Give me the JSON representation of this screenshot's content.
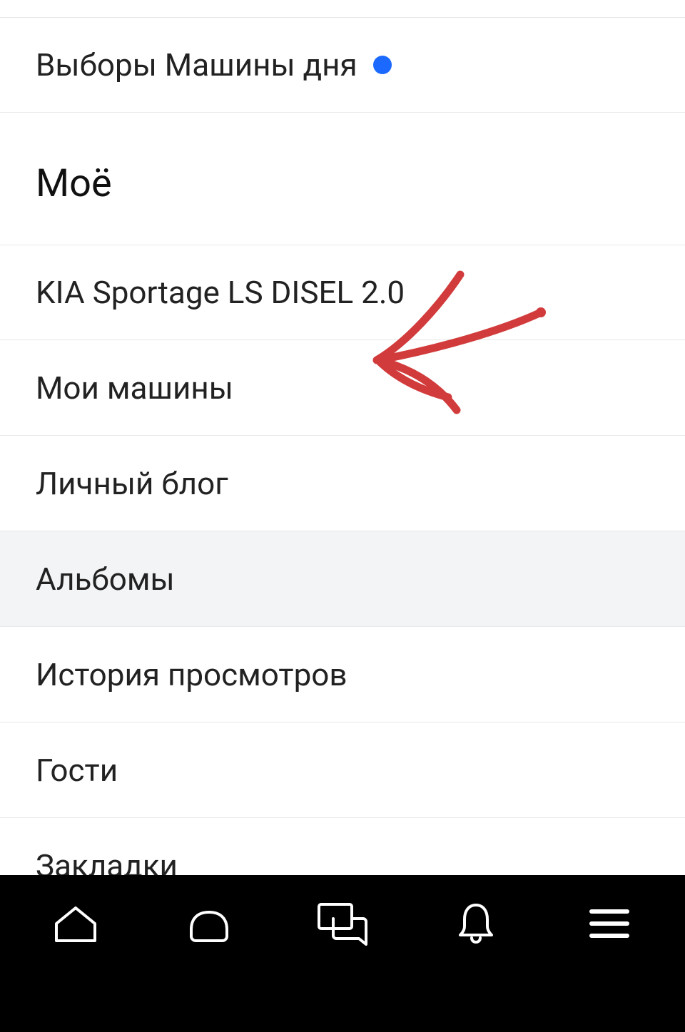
{
  "top_item": {
    "label": "Выборы Машины дня",
    "has_dot": true
  },
  "section_title": "Моё",
  "items": [
    {
      "label": "KIA Sportage LS DISEL 2.0",
      "selected": false
    },
    {
      "label": "Мои машины",
      "selected": false
    },
    {
      "label": "Личный блог",
      "selected": false
    },
    {
      "label": "Альбомы",
      "selected": true
    },
    {
      "label": "История просмотров",
      "selected": false
    },
    {
      "label": "Гости",
      "selected": false
    },
    {
      "label": "Закладки",
      "selected": false
    }
  ],
  "annotation": {
    "color": "#d23b3b"
  },
  "bottombar": {
    "icons": [
      "home-icon",
      "car-icon",
      "messages-icon",
      "bell-icon",
      "menu-icon"
    ],
    "icon_color": "#ffffff"
  }
}
